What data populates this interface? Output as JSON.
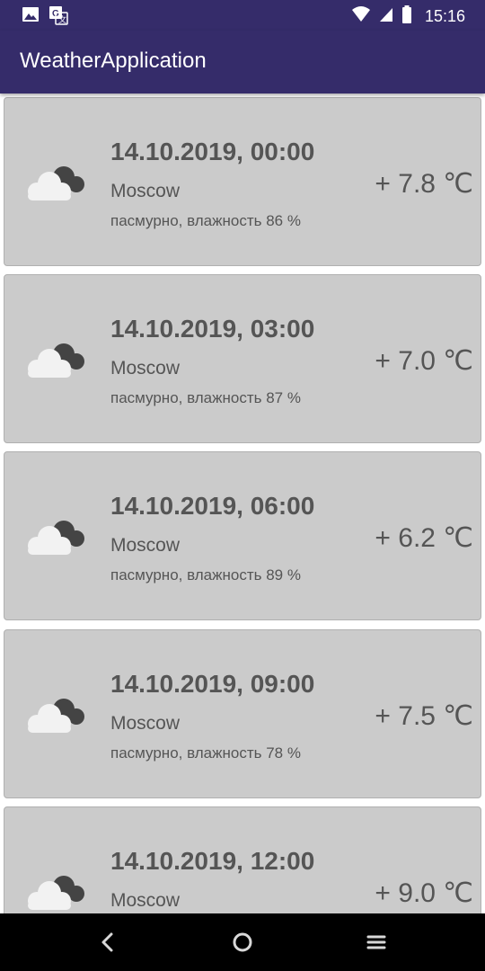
{
  "status_bar": {
    "time": "15:16",
    "left_icons": [
      "image-icon",
      "translate-icon"
    ],
    "right_icons": [
      "wifi-icon",
      "signal-icon",
      "battery-icon"
    ]
  },
  "app_bar": {
    "title": "WeatherApplication",
    "color": "#352c6a"
  },
  "forecast": {
    "items": [
      {
        "date": "14.10.2019, 00:00",
        "city": "Moscow",
        "description": "пасмурно, влажность 86 %",
        "temperature": "+ 7.8 ℃",
        "icon": "cloudy-icon"
      },
      {
        "date": "14.10.2019, 03:00",
        "city": "Moscow",
        "description": "пасмурно, влажность 87 %",
        "temperature": "+ 7.0 ℃",
        "icon": "cloudy-icon"
      },
      {
        "date": "14.10.2019, 06:00",
        "city": "Moscow",
        "description": "пасмурно, влажность 89 %",
        "temperature": "+ 6.2 ℃",
        "icon": "cloudy-icon"
      },
      {
        "date": "14.10.2019, 09:00",
        "city": "Moscow",
        "description": "пасмурно, влажность 78 %",
        "temperature": "+ 7.5 ℃",
        "icon": "cloudy-icon"
      },
      {
        "date": "14.10.2019, 12:00",
        "city": "Moscow",
        "description": "",
        "temperature": "+ 9.0 ℃",
        "icon": "cloudy-icon"
      }
    ]
  },
  "nav_bar": {
    "buttons": [
      "back-icon",
      "home-icon",
      "menu-icon"
    ]
  },
  "colors": {
    "card_background": "#cbcbcb",
    "text": "#555555"
  }
}
